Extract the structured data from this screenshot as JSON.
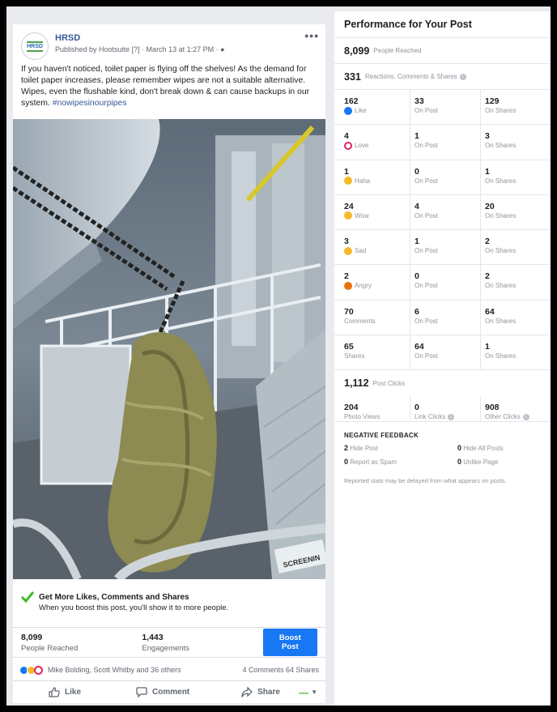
{
  "post": {
    "page_name": "HRSD",
    "logo_text": "HRSD",
    "meta": "Published by Hootsuite [?] · March 13 at 1:27 PM · ",
    "more": "•••",
    "text": "If you haven't noticed, toilet paper is flying off the shelves! As the demand for toilet paper increases, please remember wipes are not a suitable alternative. Wipes, even the flushable kind, don't break down & can cause backups in our system. ",
    "hashtag": "#nowipesinourpipes",
    "photo_label": "SCREENIN",
    "promo_title": "Get More Likes, Comments and Shares",
    "promo_sub": "When you boost this post, you'll show it to more people.",
    "reached_num": "8,099",
    "reached_label": "People Reached",
    "engagements_num": "1,443",
    "engagements_label": "Engagements",
    "boost_label": "Boost Post",
    "reaction_names": "Mike Bolding, Scott Whitby and 36 others",
    "counts": "4 Comments  64 Shares",
    "actions": {
      "like": "Like",
      "comment": "Comment",
      "share": "Share"
    }
  },
  "performance": {
    "title": "Performance for Your Post",
    "reached": {
      "num": "8,099",
      "label": "People Reached"
    },
    "engagement": {
      "num": "331",
      "label": "Reactions, Comments & Shares"
    },
    "rows": [
      {
        "icon": "like-icon",
        "total": "162",
        "label": "Like",
        "on_post": "33",
        "on_shares": "129"
      },
      {
        "icon": "love-icon",
        "total": "4",
        "label": "Love",
        "on_post": "1",
        "on_shares": "3"
      },
      {
        "icon": "haha-icon",
        "total": "1",
        "label": "Haha",
        "on_post": "0",
        "on_shares": "1"
      },
      {
        "icon": "wow-icon",
        "total": "24",
        "label": "Wow",
        "on_post": "4",
        "on_shares": "20"
      },
      {
        "icon": "sad-icon",
        "total": "3",
        "label": "Sad",
        "on_post": "1",
        "on_shares": "2"
      },
      {
        "icon": "angry-icon",
        "total": "2",
        "label": "Angry",
        "on_post": "0",
        "on_shares": "2"
      },
      {
        "icon": "",
        "total": "70",
        "label": "Comments",
        "on_post": "6",
        "on_shares": "64"
      },
      {
        "icon": "",
        "total": "65",
        "label": "Shares",
        "on_post": "64",
        "on_shares": "1"
      }
    ],
    "on_post_label": "On Post",
    "on_shares_label": "On Shares",
    "post_clicks": {
      "num": "1,112",
      "label": "Post Clicks"
    },
    "clicks": {
      "photo_views": {
        "num": "204",
        "label": "Photo Views"
      },
      "link_clicks": {
        "num": "0",
        "label": "Link Clicks"
      },
      "other_clicks": {
        "num": "908",
        "label": "Other Clicks"
      }
    },
    "negative_title": "NEGATIVE FEEDBACK",
    "negative": {
      "hide_post": {
        "num": "2",
        "label": "Hide Post"
      },
      "hide_all": {
        "num": "0",
        "label": "Hide All Posts"
      },
      "spam": {
        "num": "0",
        "label": "Report as Spam"
      },
      "unlike": {
        "num": "0",
        "label": "Unlike Page"
      }
    },
    "note": "Reported stats may be delayed from what appears on posts."
  },
  "colors": {
    "accent": "#1877f2",
    "page_link": "#385898",
    "check": "#42b72a"
  }
}
